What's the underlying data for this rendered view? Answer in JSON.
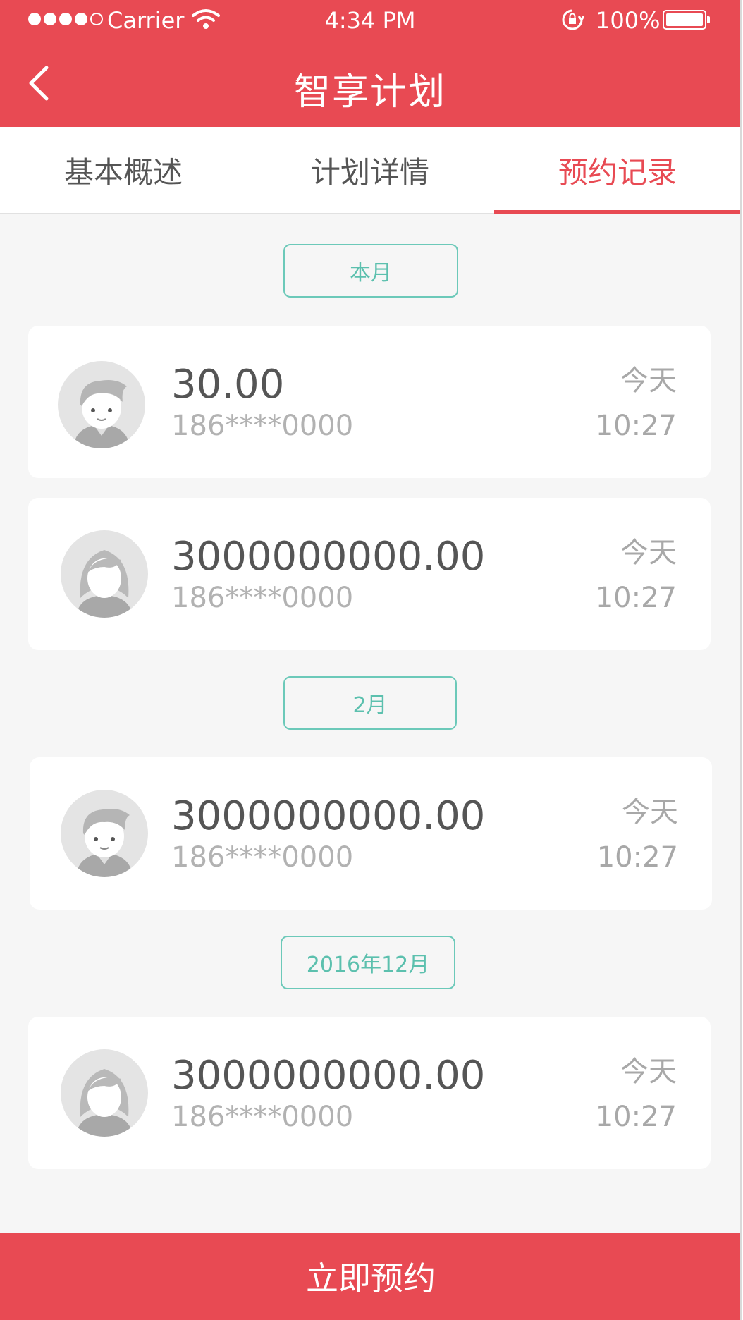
{
  "status_bar": {
    "carrier": "Carrier",
    "time": "4:34 PM",
    "battery": "100%"
  },
  "nav": {
    "title": "智享计划"
  },
  "tabs": [
    {
      "label": "基本概述",
      "active": false
    },
    {
      "label": "计划详情",
      "active": false
    },
    {
      "label": "预约记录",
      "active": true
    }
  ],
  "groups": [
    {
      "month": "本月",
      "records": [
        {
          "avatar": "male-avatar-icon",
          "amount": "30.00",
          "phone": "186****0000",
          "day": "今天",
          "time": "10:27"
        },
        {
          "avatar": "female-avatar-icon",
          "amount": "3000000000.00",
          "phone": "186****0000",
          "day": "今天",
          "time": "10:27"
        }
      ]
    },
    {
      "month": "2月",
      "records": [
        {
          "avatar": "male-avatar-icon",
          "amount": "3000000000.00",
          "phone": "186****0000",
          "day": "今天",
          "time": "10:27"
        }
      ]
    },
    {
      "month": "2016年12月",
      "records": [
        {
          "avatar": "female-avatar-icon",
          "amount": "3000000000.00",
          "phone": "186****0000",
          "day": "今天",
          "time": "10:27"
        }
      ]
    }
  ],
  "action": {
    "label": "立即预约"
  },
  "colors": {
    "brand": "#e84a53",
    "accent": "#5cc0ae",
    "background": "#f6f6f6"
  }
}
